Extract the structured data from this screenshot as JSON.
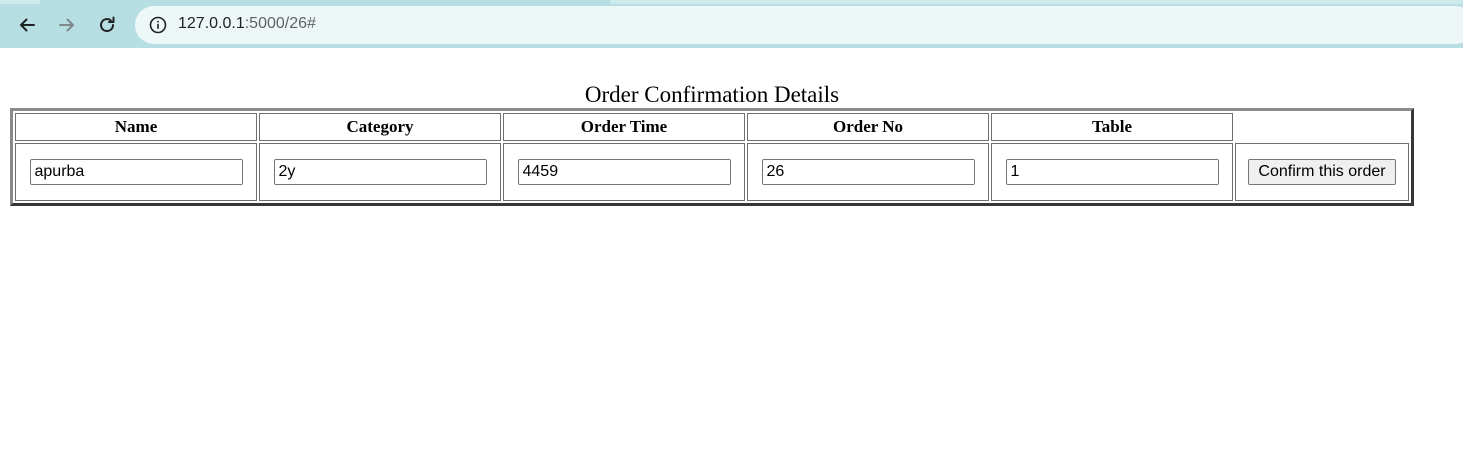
{
  "browser": {
    "url_host": "127.0.0.1",
    "url_path": ":5000/26#"
  },
  "page": {
    "title": "Order Confirmation Details"
  },
  "table": {
    "headers": [
      "Name",
      "Category",
      "Order Time",
      "Order No",
      "Table"
    ],
    "row": {
      "name": "apurba",
      "category": "2y",
      "order_time": "4459",
      "order_no": "26",
      "table": "1"
    },
    "confirm_label": "Confirm this order"
  },
  "icons": {
    "back": "back-arrow-icon",
    "forward": "forward-arrow-icon",
    "reload": "reload-icon",
    "info": "info-icon"
  },
  "colors": {
    "browser_chrome": "#b7dfe3",
    "address_bar": "#eef7f8"
  }
}
